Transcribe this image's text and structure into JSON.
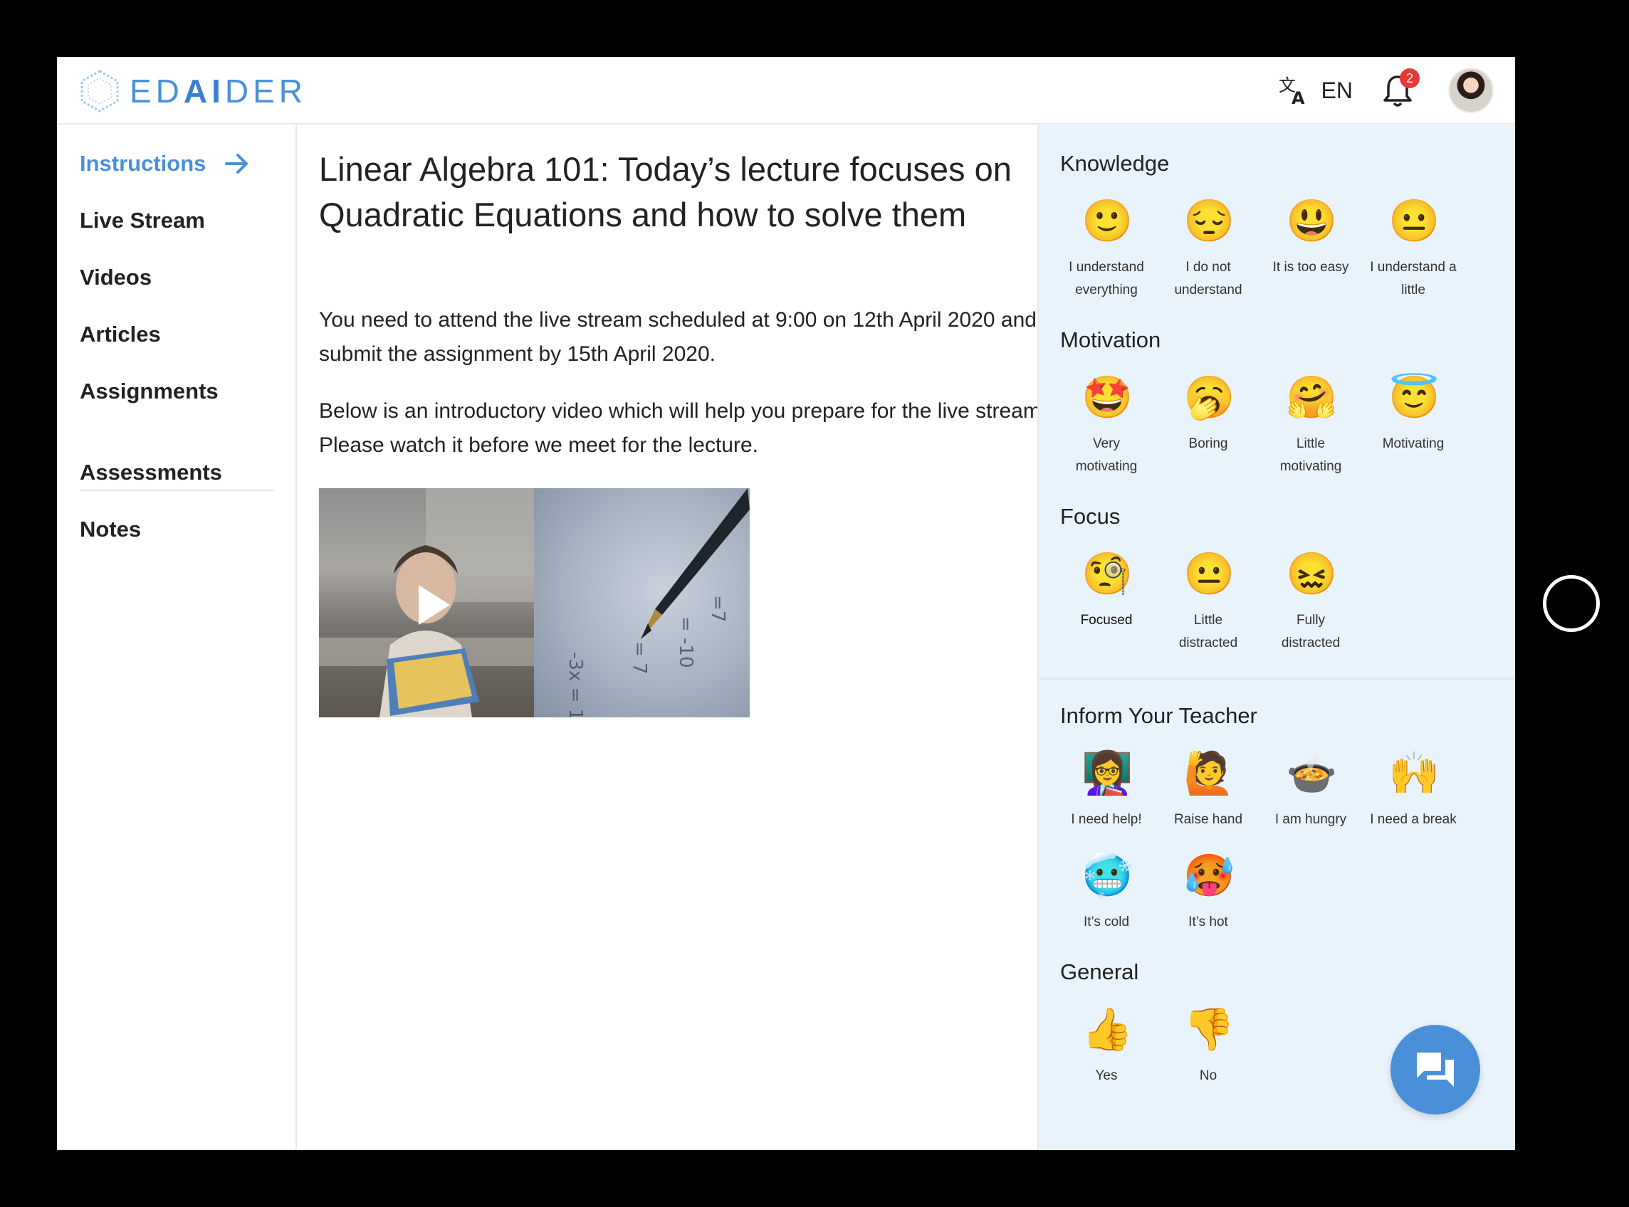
{
  "brand": {
    "logo_pre": "ED",
    "logo_mid": "AI",
    "logo_post": "DER"
  },
  "header": {
    "language": "EN",
    "notification_count": "2"
  },
  "sidebar": {
    "items": [
      {
        "label": "Instructions"
      },
      {
        "label": "Live Stream"
      },
      {
        "label": "Videos"
      },
      {
        "label": "Articles"
      },
      {
        "label": "Assignments"
      },
      {
        "label": "Assessments"
      },
      {
        "label": "Notes"
      }
    ]
  },
  "main": {
    "title": "Linear Algebra 101: Today’s lecture focuses on Quadratic Equations and how to solve them",
    "paragraph1": "You need to attend the live stream scheduled at 9:00 on 12th April 2020 and submit the assignment by 15th April 2020.",
    "paragraph2": "Below is an introductory video which will help you prepare for the live stream. Please watch it before we meet for the lecture."
  },
  "panel": {
    "knowledge": {
      "title": "Knowledge",
      "items": [
        {
          "icon": "slight-smile-icon",
          "glyph": "🙂",
          "label1": "I understand",
          "label2": "everything"
        },
        {
          "icon": "pensive-face-icon",
          "glyph": "😔",
          "label1": "I do not",
          "label2": "understand"
        },
        {
          "icon": "grinning-face-icon",
          "glyph": "😃",
          "label1": "It is too easy",
          "label2": ""
        },
        {
          "icon": "neutral-face-icon",
          "glyph": "😐",
          "label1": "I understand a",
          "label2": "little"
        }
      ]
    },
    "motivation": {
      "title": "Motivation",
      "items": [
        {
          "icon": "star-struck-icon",
          "glyph": "🤩",
          "label1": "Very",
          "label2": "motivating"
        },
        {
          "icon": "yawning-face-icon",
          "glyph": "🥱",
          "label1": "Boring",
          "label2": ""
        },
        {
          "icon": "hugging-face-icon",
          "glyph": "🤗",
          "label1": "Little",
          "label2": "motivating"
        },
        {
          "icon": "halo-face-icon",
          "glyph": "😇",
          "label1": "Motivating",
          "label2": ""
        }
      ]
    },
    "focus": {
      "title": "Focus",
      "items": [
        {
          "icon": "monocle-face-icon",
          "glyph": "🧐",
          "label1": "Focused",
          "label2": ""
        },
        {
          "icon": "neutral-face-icon",
          "glyph": "😐",
          "label1": "Little",
          "label2": "distracted"
        },
        {
          "icon": "confounded-face-icon",
          "glyph": "😖",
          "label1": "Fully",
          "label2": "distracted"
        }
      ]
    },
    "inform": {
      "title": "Inform Your Teacher",
      "items": [
        {
          "icon": "teacher-icon",
          "glyph": "👩‍🏫",
          "label1": "I need help!"
        },
        {
          "icon": "raising-hand-icon",
          "glyph": "🙋",
          "label1": "Raise hand"
        },
        {
          "icon": "food-bowl-icon",
          "glyph": "🍲",
          "label1": "I am hungry"
        },
        {
          "icon": "raised-hands-icon",
          "glyph": "🙌",
          "label1": "I need a break"
        },
        {
          "icon": "cold-face-icon",
          "glyph": "🥶",
          "label1": "It’s cold"
        },
        {
          "icon": "hot-face-icon",
          "glyph": "🥵",
          "label1": "It’s hot"
        }
      ]
    },
    "general": {
      "title": "General",
      "items": [
        {
          "icon": "thumbs-up-icon",
          "glyph": "👍",
          "label1": "Yes"
        },
        {
          "icon": "thumbs-down-icon",
          "glyph": "👎",
          "label1": "No"
        }
      ]
    }
  }
}
